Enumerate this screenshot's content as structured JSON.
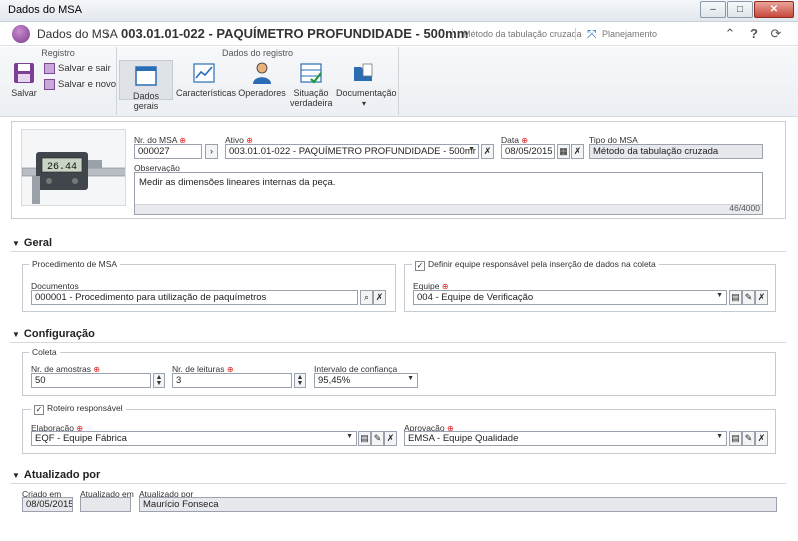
{
  "window": {
    "title": "Dados do MSA",
    "min": "–",
    "max": "□",
    "close": "✕"
  },
  "header": {
    "app": "Dados do MSA",
    "title": "003.01.01-022 - PAQUÍMETRO PROFUNDIDADE - 500mm",
    "type": "Método da tabulação cruzada",
    "plan": "Planejamento"
  },
  "ribbon": {
    "group_registro": "Registro",
    "group_dados": "Dados do registro",
    "salvar": "Salvar",
    "salvar_sair": "Salvar e sair",
    "salvar_novo": "Salvar e novo",
    "dados_gerais": "Dados gerais",
    "caracteristicas": "Características",
    "operadores": "Operadores",
    "situacao": "Situação",
    "verdadeira": "verdadeira",
    "documentacao": "Documentação",
    "doc_arrow": "▾"
  },
  "record": {
    "nr_label": "Nr. do MSA",
    "nr_value": "000027",
    "ativo_label": "Ativo",
    "ativo_value": "003.01.01-022 - PAQUÍMETRO PROFUNDIDADE - 500mr",
    "data_label": "Data",
    "data_value": "08/05/2015",
    "tipo_label": "Tipo do MSA",
    "tipo_value": "Método da tabulação cruzada",
    "obs_label": "Observação",
    "obs_value": "Medir as dimensões lineares internas da peça.",
    "obs_counter": "46/4000",
    "display": "26.44"
  },
  "geral": {
    "title": "Geral",
    "proc_legend": "Procedimento de MSA",
    "docs_label": "Documentos",
    "docs_value": "000001 - Procedimento para utilização de paquímetros",
    "equipe_check_label": "Definir equipe responsável pela inserção de dados na coleta",
    "equipe_label": "Equipe",
    "equipe_value": "004 - Equipe de Verificação"
  },
  "config": {
    "title": "Configuração",
    "coleta_legend": "Coleta",
    "amostras_label": "Nr. de amostras",
    "amostras_value": "50",
    "leituras_label": "Nr. de leituras",
    "leituras_value": "3",
    "intervalo_label": "Intervalo de confiança",
    "intervalo_value": "95,45%",
    "roteiro_legend": "Roteiro responsável",
    "elab_label": "Elaboração",
    "elab_value": "EQF - Equipe Fábrica",
    "aprov_label": "Aprovação",
    "aprov_value": "EMSA - Equipe Qualidade"
  },
  "atualizado": {
    "title": "Atualizado por",
    "criado_label": "Criado em",
    "criado_value": "08/05/2015",
    "atualizado_em_label": "Atualizado em",
    "atualizado_em_value": "",
    "atualizado_por_label": "Atualizado por",
    "atualizado_por_value": "Maurício Fonseca"
  },
  "glyphs": {
    "arrow_right": "›",
    "dropdown": "▼",
    "check": "✓",
    "triangle": "▼",
    "up": "▲",
    "down": "▼"
  }
}
